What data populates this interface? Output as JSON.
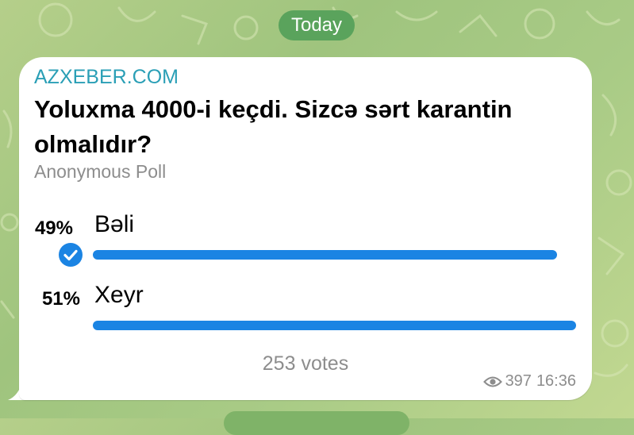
{
  "date_separator": "Today",
  "message": {
    "sender": "AZXEBER.COM",
    "poll": {
      "question": "Yoluxma 4000-i keçdi. Sizcə sərt karantin olmalıdır?",
      "type": "Anonymous Poll",
      "options": [
        {
          "percent_label": "49%",
          "label": "Bəli",
          "share": 0.49,
          "selected": true
        },
        {
          "percent_label": "51%",
          "label": "Xeyr",
          "share": 0.51,
          "selected": false
        }
      ],
      "total_votes": "253 votes"
    },
    "views": "397",
    "time": "16:36"
  },
  "colors": {
    "accent": "#1b84e3",
    "sender": "#2a9fb6",
    "date_pill": "#5aa35c",
    "muted_text": "#8d8d8d"
  },
  "icons": {
    "selected_option": "check-circle-icon",
    "views": "eye-icon"
  }
}
